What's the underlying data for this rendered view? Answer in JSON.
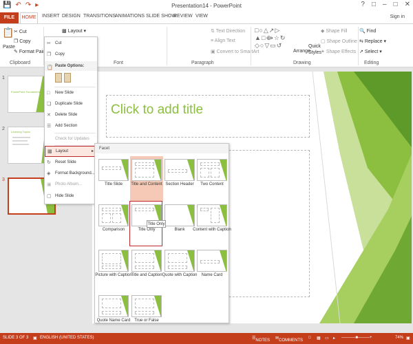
{
  "window": {
    "title": "Presentation14 - PowerPoint",
    "signin": "Sign in"
  },
  "tabs": [
    "FILE",
    "HOME",
    "INSERT",
    "DESIGN",
    "TRANSITIONS",
    "ANIMATIONS",
    "SLIDE SHOW",
    "REVIEW",
    "VIEW"
  ],
  "ribbon": {
    "paste": "Paste",
    "cut": "Cut",
    "copy": "Copy",
    "format_painter": "Format Painter",
    "layout": "Layout",
    "text_direction": "Text Direction",
    "align_text": "Align Text",
    "convert_smartart": "Convert to SmartArt",
    "arrange": "Arrange",
    "quick_styles": "Quick Styles",
    "shape_fill": "Shape Fill",
    "shape_outline": "Shape Outline",
    "shape_effects": "Shape Effects",
    "find": "Find",
    "replace": "Replace",
    "select": "Select",
    "groups": [
      "Clipboard",
      "Font",
      "Paragraph",
      "Drawing",
      "Editing"
    ]
  },
  "context_menu": {
    "items": [
      {
        "label": "Cut",
        "icon": "scissors-icon",
        "enabled": true
      },
      {
        "label": "Copy",
        "icon": "copy-icon",
        "enabled": true
      },
      {
        "label": "Paste Options:",
        "icon": "paste-icon",
        "enabled": true
      },
      {
        "label": "New Slide",
        "icon": "new-slide-icon",
        "enabled": true
      },
      {
        "label": "Duplicate Slide",
        "icon": "duplicate-icon",
        "enabled": true
      },
      {
        "label": "Delete Slide",
        "icon": "delete-icon",
        "enabled": true
      },
      {
        "label": "Add Section",
        "icon": "section-icon",
        "enabled": true
      },
      {
        "label": "Check for Updates",
        "icon": "",
        "enabled": false
      },
      {
        "label": "Layout",
        "icon": "layout-icon",
        "enabled": true
      },
      {
        "label": "Reset Slide",
        "icon": "reset-icon",
        "enabled": true
      },
      {
        "label": "Format Background...",
        "icon": "background-icon",
        "enabled": true
      },
      {
        "label": "Photo Album...",
        "icon": "album-icon",
        "enabled": false
      },
      {
        "label": "Hide Slide",
        "icon": "hide-icon",
        "enabled": true
      }
    ]
  },
  "gallery": {
    "header": "Facet",
    "layouts": [
      "Title Slide",
      "Title and Content",
      "Section Header",
      "Two Content",
      "Comparison",
      "Title Only",
      "Blank",
      "Content with Caption",
      "Picture with Caption",
      "Title and Caption",
      "Quote with Caption",
      "Name Card",
      "Quote Name Card",
      "True or False"
    ],
    "tooltip": "Title Only"
  },
  "slide": {
    "title_placeholder": "Click to add title"
  },
  "thumbnails": [
    {
      "num": "1",
      "title": "PowerPoint Fundamentals"
    },
    {
      "num": "2",
      "title": "Learning Topics"
    },
    {
      "num": "3",
      "title": ""
    }
  ],
  "status": {
    "slide": "SLIDE 3 OF 3",
    "language": "ENGLISH (UNITED STATES)",
    "notes": "NOTES",
    "comments": "COMMENTS",
    "zoom": "74%"
  },
  "colors": {
    "accent": "#c43e1c",
    "facet_green": "#8cbf3f",
    "highlight": "#c0262d"
  }
}
